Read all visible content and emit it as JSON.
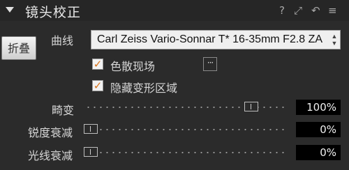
{
  "header": {
    "title": "镜头校正",
    "help_icon": "?",
    "expand_icon": "⤢",
    "reset_icon": "↶",
    "menu_icon": "≡"
  },
  "fold_button": {
    "label": "折叠"
  },
  "curve": {
    "label": "曲线",
    "selected_lens": "Carl Zeiss Vario-Sonnar T* 16-35mm F2.8 ZA"
  },
  "options": {
    "chromatic": {
      "label": "色散现场",
      "checked": true
    },
    "hide_deform": {
      "label": "隐藏变形区域",
      "checked": true
    },
    "more_label": "···"
  },
  "sliders": [
    {
      "label": "畸变",
      "value_text": "100%",
      "value": 1.0
    },
    {
      "label": "锐度衰减",
      "value_text": "0%",
      "value": 0.0
    },
    {
      "label": "光线衰减",
      "value_text": "0%",
      "value": 0.0
    }
  ],
  "colors": {
    "accent_check": "#d9731a",
    "background": "#2b2b2b"
  }
}
